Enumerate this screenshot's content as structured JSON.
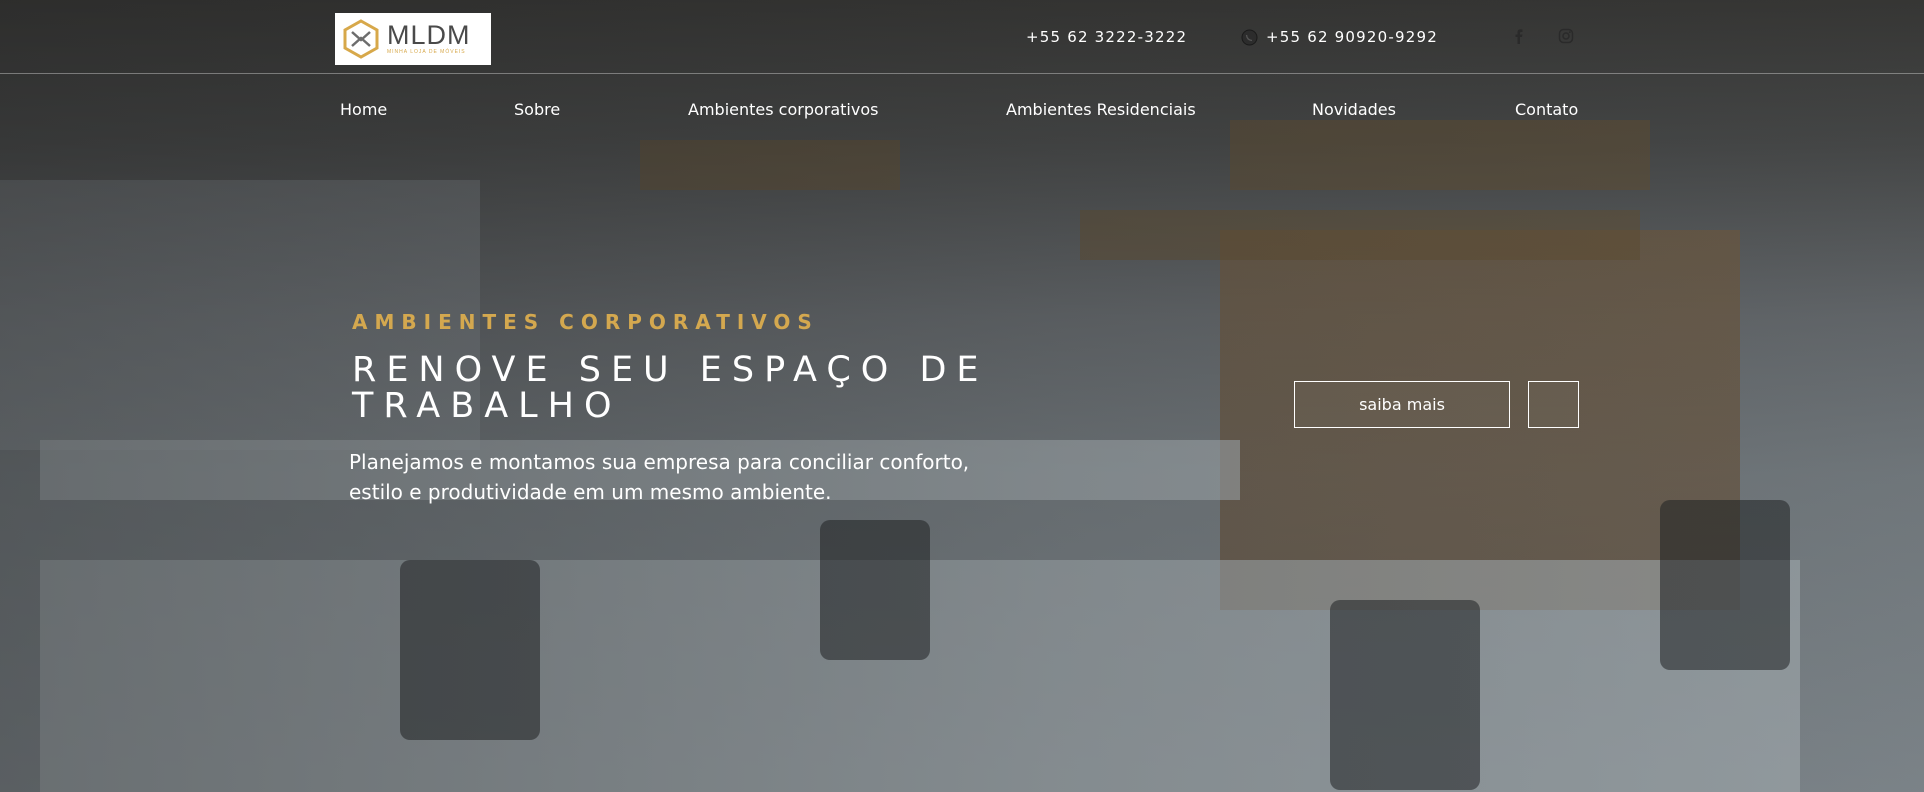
{
  "header": {
    "logo": {
      "word": "MLDM",
      "tagline": "MINHA LOJA DE MÓVEIS"
    },
    "phone_primary": "+55 62 3222-3222",
    "phone_whatsapp": "+55 62 90920-9292",
    "social": {
      "facebook_icon": "facebook-icon",
      "instagram_icon": "instagram-icon"
    }
  },
  "nav": {
    "items": [
      {
        "label": "Home"
      },
      {
        "label": "Sobre"
      },
      {
        "label": "Ambientes corporativos"
      },
      {
        "label": "Ambientes Residenciais"
      },
      {
        "label": "Novidades"
      },
      {
        "label": "Contato"
      }
    ]
  },
  "hero": {
    "kicker": "AMBIENTES CORPORATIVOS",
    "headline": "RENOVE SEU ESPAÇO DE TRABALHO",
    "subtext": "Planejamos e montamos sua empresa para conciliar conforto, estilo e produtividade em um mesmo ambiente.",
    "cta_label": "saiba mais",
    "next_icon": "arrow-icon"
  },
  "colors": {
    "accent": "#d4a84f",
    "text": "#ffffff"
  }
}
